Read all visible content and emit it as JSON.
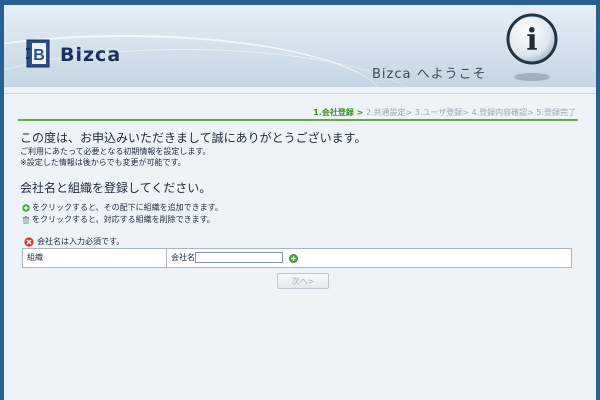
{
  "header": {
    "brand": "Bizca",
    "welcome": "Bizca へようこそ",
    "info_letter": "i",
    "logo_mark_text": "B"
  },
  "steps": {
    "active": "1.会社登録 >",
    "rest": " 2.共通設定> 3.ユーザ登録> 4.登録内容確認> 5.登録完了"
  },
  "intro": {
    "thanks": "この度は、お申込みいただきまして誠にありがとうございます。",
    "line1": "ご利用にあたって必要となる初期情報を設定します。",
    "line2": "※設定した情報は後からでも変更が可能です。"
  },
  "section_title": "会社名と組織を登録してください。",
  "hints": {
    "add": "をクリックすると、その配下に組織を追加できます。",
    "delete": "をクリックすると、対応する組織を削除できます。"
  },
  "required_note": "会社名は入力必須です。",
  "table": {
    "org_label": "組織",
    "company_label": "会社名",
    "company_value": ""
  },
  "next_button": "次へ>",
  "colors": {
    "step_active": "#3f8f24",
    "step_line": "#62a842",
    "outer_background": "#2a5f93"
  },
  "icons": {
    "info": "info-badge-icon",
    "add": "green-plus-icon",
    "delete": "trash-icon",
    "required": "red-x-icon"
  }
}
